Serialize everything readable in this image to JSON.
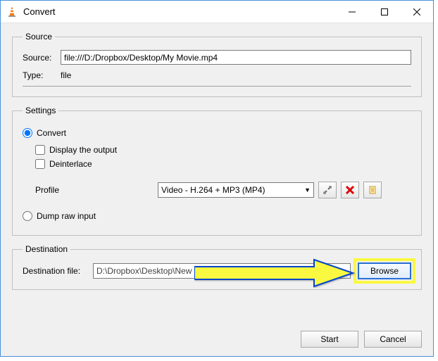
{
  "window": {
    "title": "Convert"
  },
  "source": {
    "legend": "Source",
    "source_label": "Source:",
    "source_value": "file:///D:/Dropbox/Desktop/My Movie.mp4",
    "type_label": "Type:",
    "type_value": "file"
  },
  "settings": {
    "legend": "Settings",
    "convert_label": "Convert",
    "display_output_label": "Display the output",
    "deinterlace_label": "Deinterlace",
    "profile_label": "Profile",
    "profile_selected": "Video - H.264 + MP3 (MP4)",
    "dump_label": "Dump raw input"
  },
  "destination": {
    "legend": "Destination",
    "file_label": "Destination file:",
    "file_value": "D:\\Dropbox\\Desktop\\New Movie.mp4",
    "browse_label": "Browse"
  },
  "buttons": {
    "start": "Start",
    "cancel": "Cancel"
  }
}
